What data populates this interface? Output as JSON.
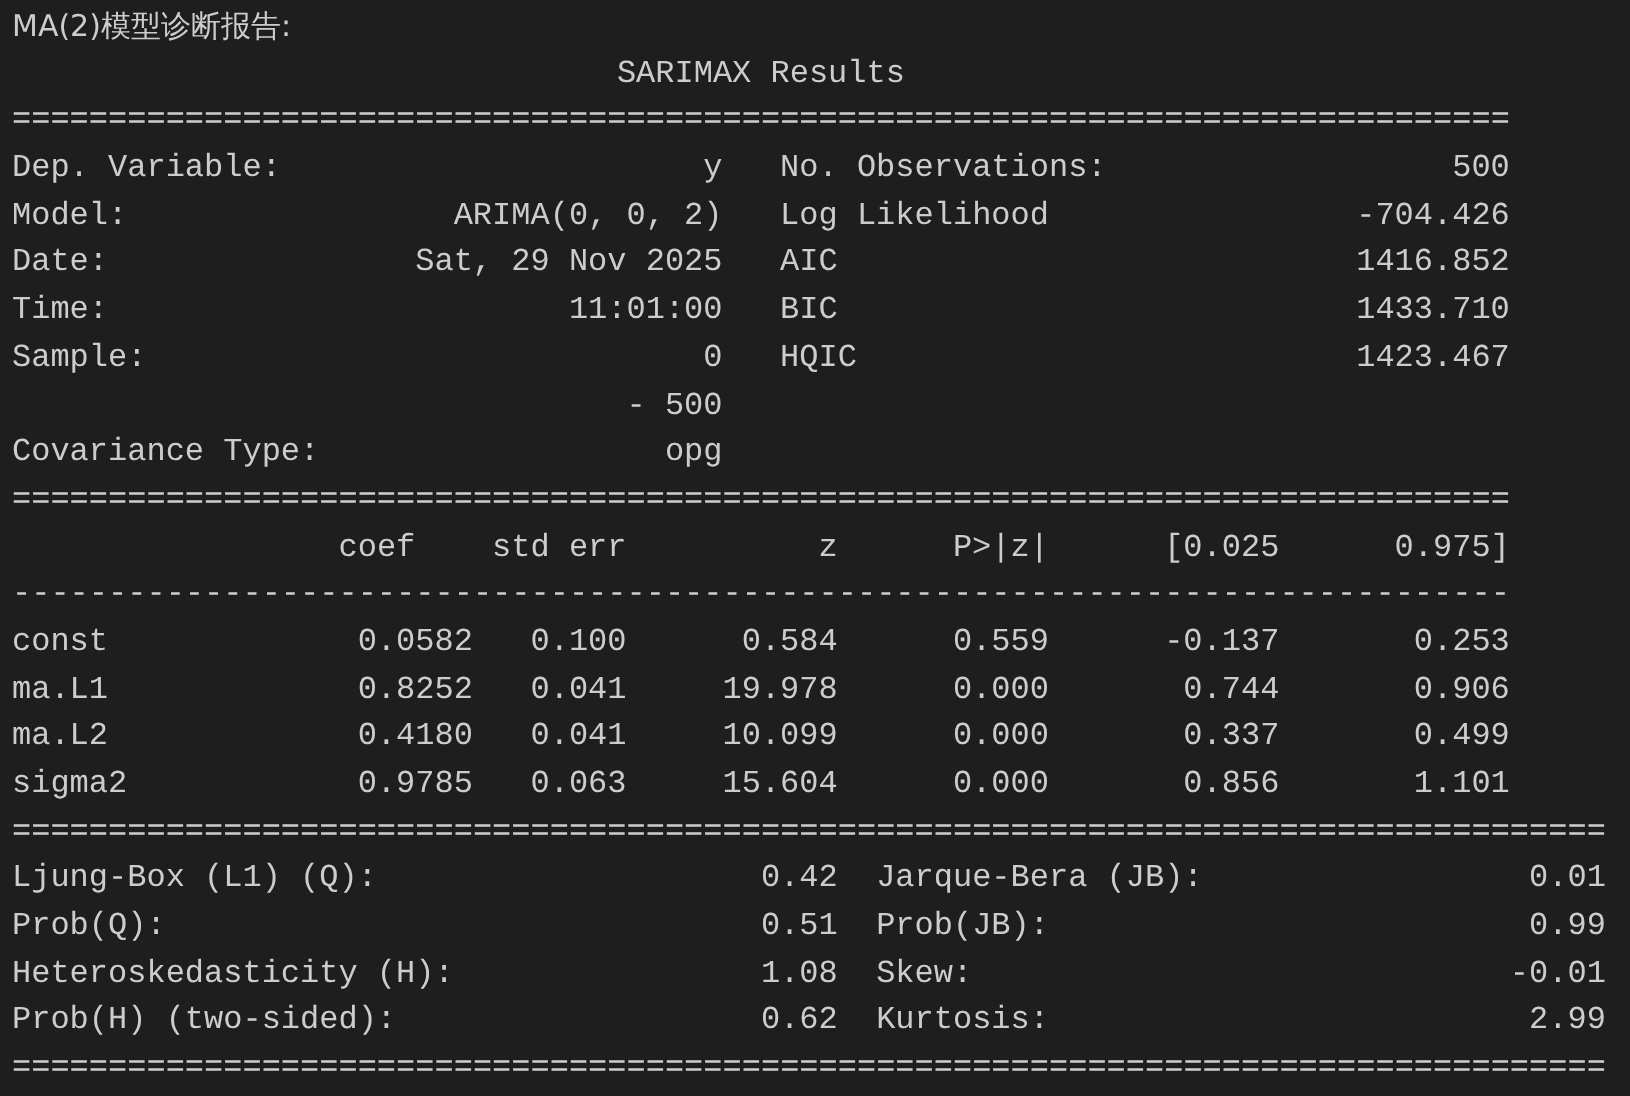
{
  "heading": "MA(2)模型诊断报告:",
  "blocks": [
    {
      "kind": "title",
      "text": "SARIMAX Results"
    },
    {
      "kind": "rule",
      "text": "=============================================================================="
    },
    {
      "kind": "info",
      "rows": [
        {
          "label": "Dep. Variable:",
          "value": "y",
          "label2": "No. Observations:",
          "value2": "500"
        },
        {
          "label": "Model:",
          "value": "ARIMA(0, 0, 2)",
          "label2": "Log Likelihood",
          "value2": "-704.426"
        },
        {
          "label": "Date:",
          "value": "Sat, 29 Nov 2025",
          "label2": "AIC",
          "value2": "1416.852"
        },
        {
          "label": "Time:",
          "value": "11:01:00",
          "label2": "BIC",
          "value2": "1433.710"
        },
        {
          "label": "Sample:",
          "value": "0",
          "label2": "HQIC",
          "value2": "1423.467"
        },
        {
          "value": "- 500"
        },
        {
          "label": "Covariance Type:",
          "value": "opg"
        }
      ]
    },
    {
      "kind": "rule",
      "text": "=============================================================================="
    },
    {
      "kind": "coef_header",
      "cells": [
        "coef",
        "std err",
        "z",
        "P>|z|",
        "[0.025",
        "0.975]"
      ]
    },
    {
      "kind": "rule",
      "text": "------------------------------------------------------------------------------"
    },
    {
      "kind": "coef",
      "rows": [
        {
          "name": "const",
          "values": [
            "0.0582",
            "0.100",
            "0.584",
            "0.559",
            "-0.137",
            "0.253"
          ]
        },
        {
          "name": "ma.L1",
          "values": [
            "0.8252",
            "0.041",
            "19.978",
            "0.000",
            "0.744",
            "0.906"
          ]
        },
        {
          "name": "ma.L2",
          "values": [
            "0.4180",
            "0.041",
            "10.099",
            "0.000",
            "0.337",
            "0.499"
          ]
        },
        {
          "name": "sigma2",
          "values": [
            "0.9785",
            "0.063",
            "15.604",
            "0.000",
            "0.856",
            "1.101"
          ]
        }
      ]
    },
    {
      "kind": "rule",
      "text": "==================================================================================="
    },
    {
      "kind": "diag",
      "rows": [
        {
          "label": "Ljung-Box (L1) (Q):",
          "value": "0.42",
          "label2": "Jarque-Bera (JB):",
          "value2": "0.01"
        },
        {
          "label": "Prob(Q):",
          "value": "0.51",
          "label2": "Prob(JB):",
          "value2": "0.99"
        },
        {
          "label": "Heteroskedasticity (H):",
          "value": "1.08",
          "label2": "Skew:",
          "value2": "-0.01"
        },
        {
          "label": "Prob(H) (two-sided):",
          "value": "0.62",
          "label2": "Kurtosis:",
          "value2": "2.99"
        }
      ]
    },
    {
      "kind": "rule",
      "text": "==================================================================================="
    }
  ]
}
